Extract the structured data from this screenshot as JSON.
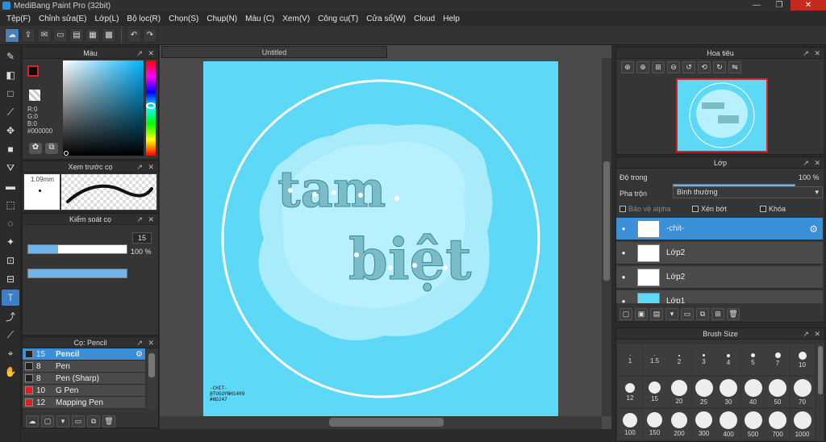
{
  "app": {
    "title": "MediBang Paint Pro (32bit)"
  },
  "window_buttons": [
    "—",
    "❐",
    "✕"
  ],
  "menu": [
    "Tệp(F)",
    "Chỉnh sửa(E)",
    "Lớp(L)",
    "Bộ lọc(R)",
    "Chọn(S)",
    "Chụp(N)",
    "Màu (C)",
    "Xem(V)",
    "Công cụ(T)",
    "Cửa sổ(W)",
    "Cloud",
    "Help"
  ],
  "toolbar_icons": [
    "cloud-icon",
    "export-icon",
    "chat-icon",
    "comment-icon",
    "page-icon",
    "panel-icon",
    "grid-icon",
    "undo-icon",
    "redo-icon"
  ],
  "color_panel": {
    "title": "Màu",
    "r": "R:0",
    "g": "G:0",
    "b": "B:0",
    "hex": "#000000",
    "fg": "#000000",
    "bg": "#ffffff"
  },
  "brush_preview": {
    "title": "Xem trước cọ",
    "size": "1.09mm"
  },
  "brush_control": {
    "title": "Kiểm soát cọ",
    "size_value": "15",
    "size_fraction": 0.3,
    "opacity_value": "100 %",
    "opacity_fraction": 1.0
  },
  "brush_panel": {
    "title": "Cọ: Pencil",
    "items": [
      {
        "size": "15",
        "name": "Pencil",
        "color": "#222222",
        "selected": true
      },
      {
        "size": "8",
        "name": "Pen",
        "color": "#222222",
        "selected": false
      },
      {
        "size": "8",
        "name": "Pen (Sharp)",
        "color": "#222222",
        "selected": false
      },
      {
        "size": "10",
        "name": "G Pen",
        "color": "#e02020",
        "selected": false
      },
      {
        "size": "12",
        "name": "Mapping Pen",
        "color": "#e02020",
        "selected": false
      }
    ]
  },
  "document": {
    "tab": "Untitled"
  },
  "artwork": {
    "bg_color": "#5ed8f7",
    "line1": "tam",
    "line2": "biệt",
    "credit1": "-CHIT-",
    "credit2": "@TUGUYNH1409",
    "credit3": "#HD247"
  },
  "navigator": {
    "title": "Hoa tiêu"
  },
  "layers": {
    "title": "Lớp",
    "opacity_label": "Độ trong",
    "opacity_value": "100 %",
    "opacity_fraction": 1.0,
    "blend_label": "Pha trộn",
    "blend_value": "Bình thường",
    "protect_alpha": "Bảo vệ alpha",
    "clip": "Xén bớt",
    "lock": "Khóa",
    "items": [
      {
        "name": "-chit-",
        "selected": true
      },
      {
        "name": "Lớp2",
        "selected": false
      },
      {
        "name": "Lớp2",
        "selected": false
      },
      {
        "name": "Lớp1",
        "selected": false
      }
    ]
  },
  "brush_size": {
    "title": "Brush Size",
    "sizes": [
      "1",
      "1.5",
      "2",
      "3",
      "4",
      "5",
      "7",
      "10",
      "12",
      "15",
      "20",
      "25",
      "30",
      "40",
      "50",
      "70",
      "100",
      "150",
      "200",
      "300",
      "400",
      "500",
      "700",
      "1000"
    ]
  }
}
